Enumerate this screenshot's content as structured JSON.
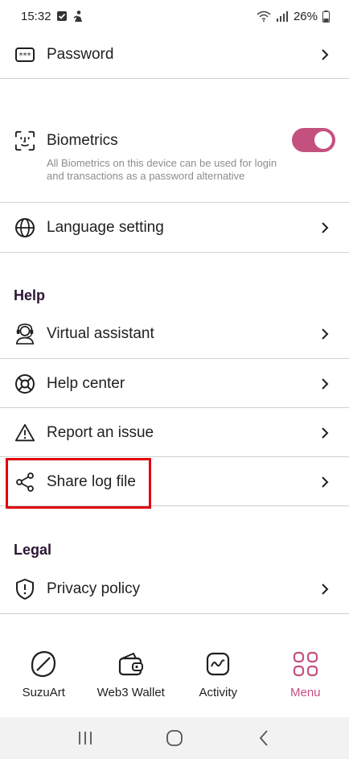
{
  "status_bar": {
    "time": "15:32",
    "battery": "26%"
  },
  "settings": {
    "password_label": "Password",
    "biometrics_label": "Biometrics",
    "biometrics_desc": "All Biometrics on this device can be used for login and transactions as a password alternative",
    "biometrics_enabled": true,
    "language_label": "Language setting"
  },
  "help": {
    "title": "Help",
    "items": [
      {
        "label": "Virtual assistant"
      },
      {
        "label": "Help center"
      },
      {
        "label": "Report an issue"
      },
      {
        "label": "Share log file"
      }
    ]
  },
  "legal": {
    "title": "Legal",
    "items": [
      {
        "label": "Privacy policy"
      }
    ]
  },
  "bottom_nav": {
    "items": [
      {
        "label": "SuzuArt"
      },
      {
        "label": "Web3 Wallet"
      },
      {
        "label": "Activity"
      },
      {
        "label": "Menu"
      }
    ],
    "active": "Menu"
  },
  "colors": {
    "accent": "#c4507f",
    "highlight": "#e0000f",
    "section_title": "#2b1533",
    "divider": "#cfcfcf"
  },
  "icons": {
    "password": "password-dots-icon",
    "biometrics": "face-id-icon",
    "language": "globe-icon",
    "virtual_assistant": "headset-agent-icon",
    "help_center": "lifebuoy-icon",
    "report_issue": "warning-triangle-icon",
    "share_log": "share-icon",
    "privacy_policy": "shield-exclamation-icon"
  }
}
